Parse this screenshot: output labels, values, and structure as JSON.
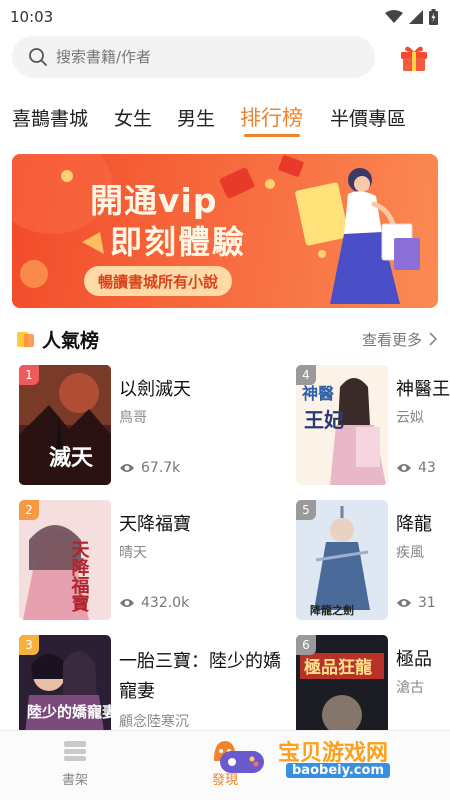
{
  "status": {
    "time": "10:03"
  },
  "search": {
    "placeholder": "搜索書籍/作者"
  },
  "tabs": [
    {
      "label": "喜鵲書城"
    },
    {
      "label": "女生"
    },
    {
      "label": "男生"
    },
    {
      "label": "排行榜",
      "active": true
    },
    {
      "label": "半價專區"
    }
  ],
  "banner": {
    "title_line1": "開通vip",
    "title_line2": "即刻體驗",
    "subtitle": "暢讀書城所有小說"
  },
  "section": {
    "title": "人氣榜",
    "more_label": "查看更多"
  },
  "books": [
    {
      "rank": "1",
      "title": "以劍滅天",
      "author": "鳥哥",
      "views": "67.7k",
      "rank_color": "#ef5a5a"
    },
    {
      "rank": "2",
      "title": "天降福寶",
      "author": "晴天",
      "views": "432.0k",
      "rank_color": "#f49a45"
    },
    {
      "rank": "3",
      "title": "一胎三寶：陸少的嬌寵妻",
      "author": "顧念陸寒沉",
      "views": "",
      "rank_color": "#f4b23d"
    },
    {
      "rank": "4",
      "title": "神醫王",
      "author": "云姒",
      "views": "43",
      "rank_color": "#9a9a9a"
    },
    {
      "rank": "5",
      "title": "降龍",
      "author": "疾風",
      "views": "31",
      "rank_color": "#9a9a9a"
    },
    {
      "rank": "6",
      "title": "極品",
      "author": "滄古",
      "views": "",
      "rank_color": "#9a9a9a"
    }
  ],
  "cover_text": {
    "c1": "滅天",
    "c2": "天降福寶",
    "c3": "陸少的嬌寵妻",
    "c4_a": "神醫",
    "c4_b": "王妃",
    "c5": "降龍之劍",
    "c6": "極品狂龍"
  },
  "nav": {
    "shelf_label": "書架",
    "discover_label": "發現",
    "active_color": "#f0842b"
  },
  "watermark": {
    "text": "宝贝游戏网",
    "url": "baobeiy.com"
  },
  "colors": {
    "accent": "#f0842b",
    "banner": "#f4582f"
  }
}
